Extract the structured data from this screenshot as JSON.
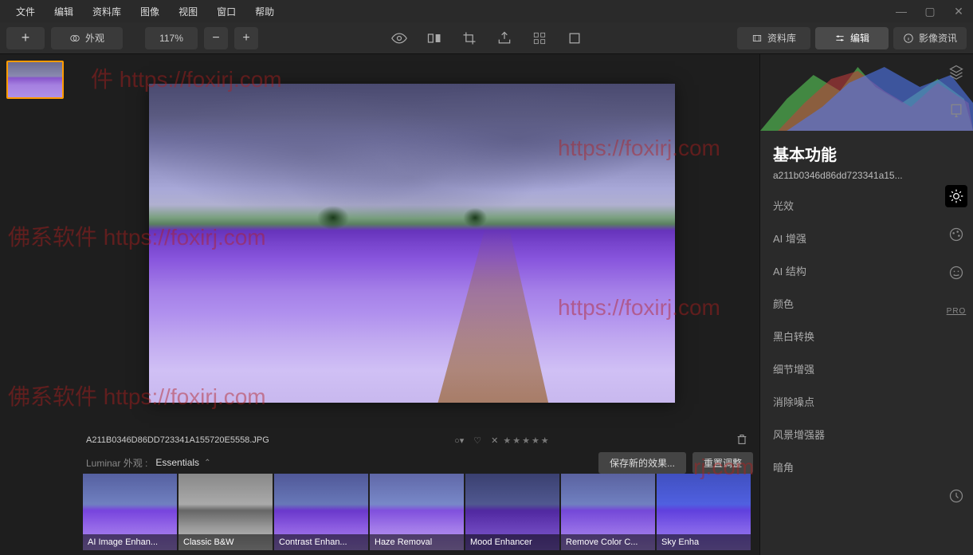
{
  "menu": [
    "文件",
    "编辑",
    "资料库",
    "图像",
    "视图",
    "窗口",
    "帮助"
  ],
  "toolbar": {
    "look_label": "外观",
    "zoom": "117%"
  },
  "tabs": {
    "library": "资料库",
    "edit": "编辑",
    "info": "影像资讯"
  },
  "filename_upper": "A211B0346D86DD723341A155720E5558.JPG",
  "stars": "★★★★★",
  "looks": {
    "label": "Luminar 外观 :",
    "category": "Essentials",
    "save_new": "保存新的效果...",
    "reset": "重置调整"
  },
  "presets": [
    "AI Image Enhan...",
    "Classic B&W",
    "Contrast Enhan...",
    "Haze Removal",
    "Mood Enhancer",
    "Remove Color C...",
    "Sky Enha"
  ],
  "panel": {
    "title": "基本功能",
    "filename": "a211b0346d86dd723341a15...",
    "items": [
      "光效",
      "AI 增强",
      "AI 结构",
      "颜色",
      "黑白转换",
      "细节增强",
      "消除噪点",
      "风景增强器",
      "暗角"
    ]
  },
  "pro": "PRO",
  "watermarks": {
    "w1_partial": "件 https://foxirj.com",
    "w2": "佛系软件 https://foxirj.com",
    "w3_partial": "https://foxirj.com"
  }
}
